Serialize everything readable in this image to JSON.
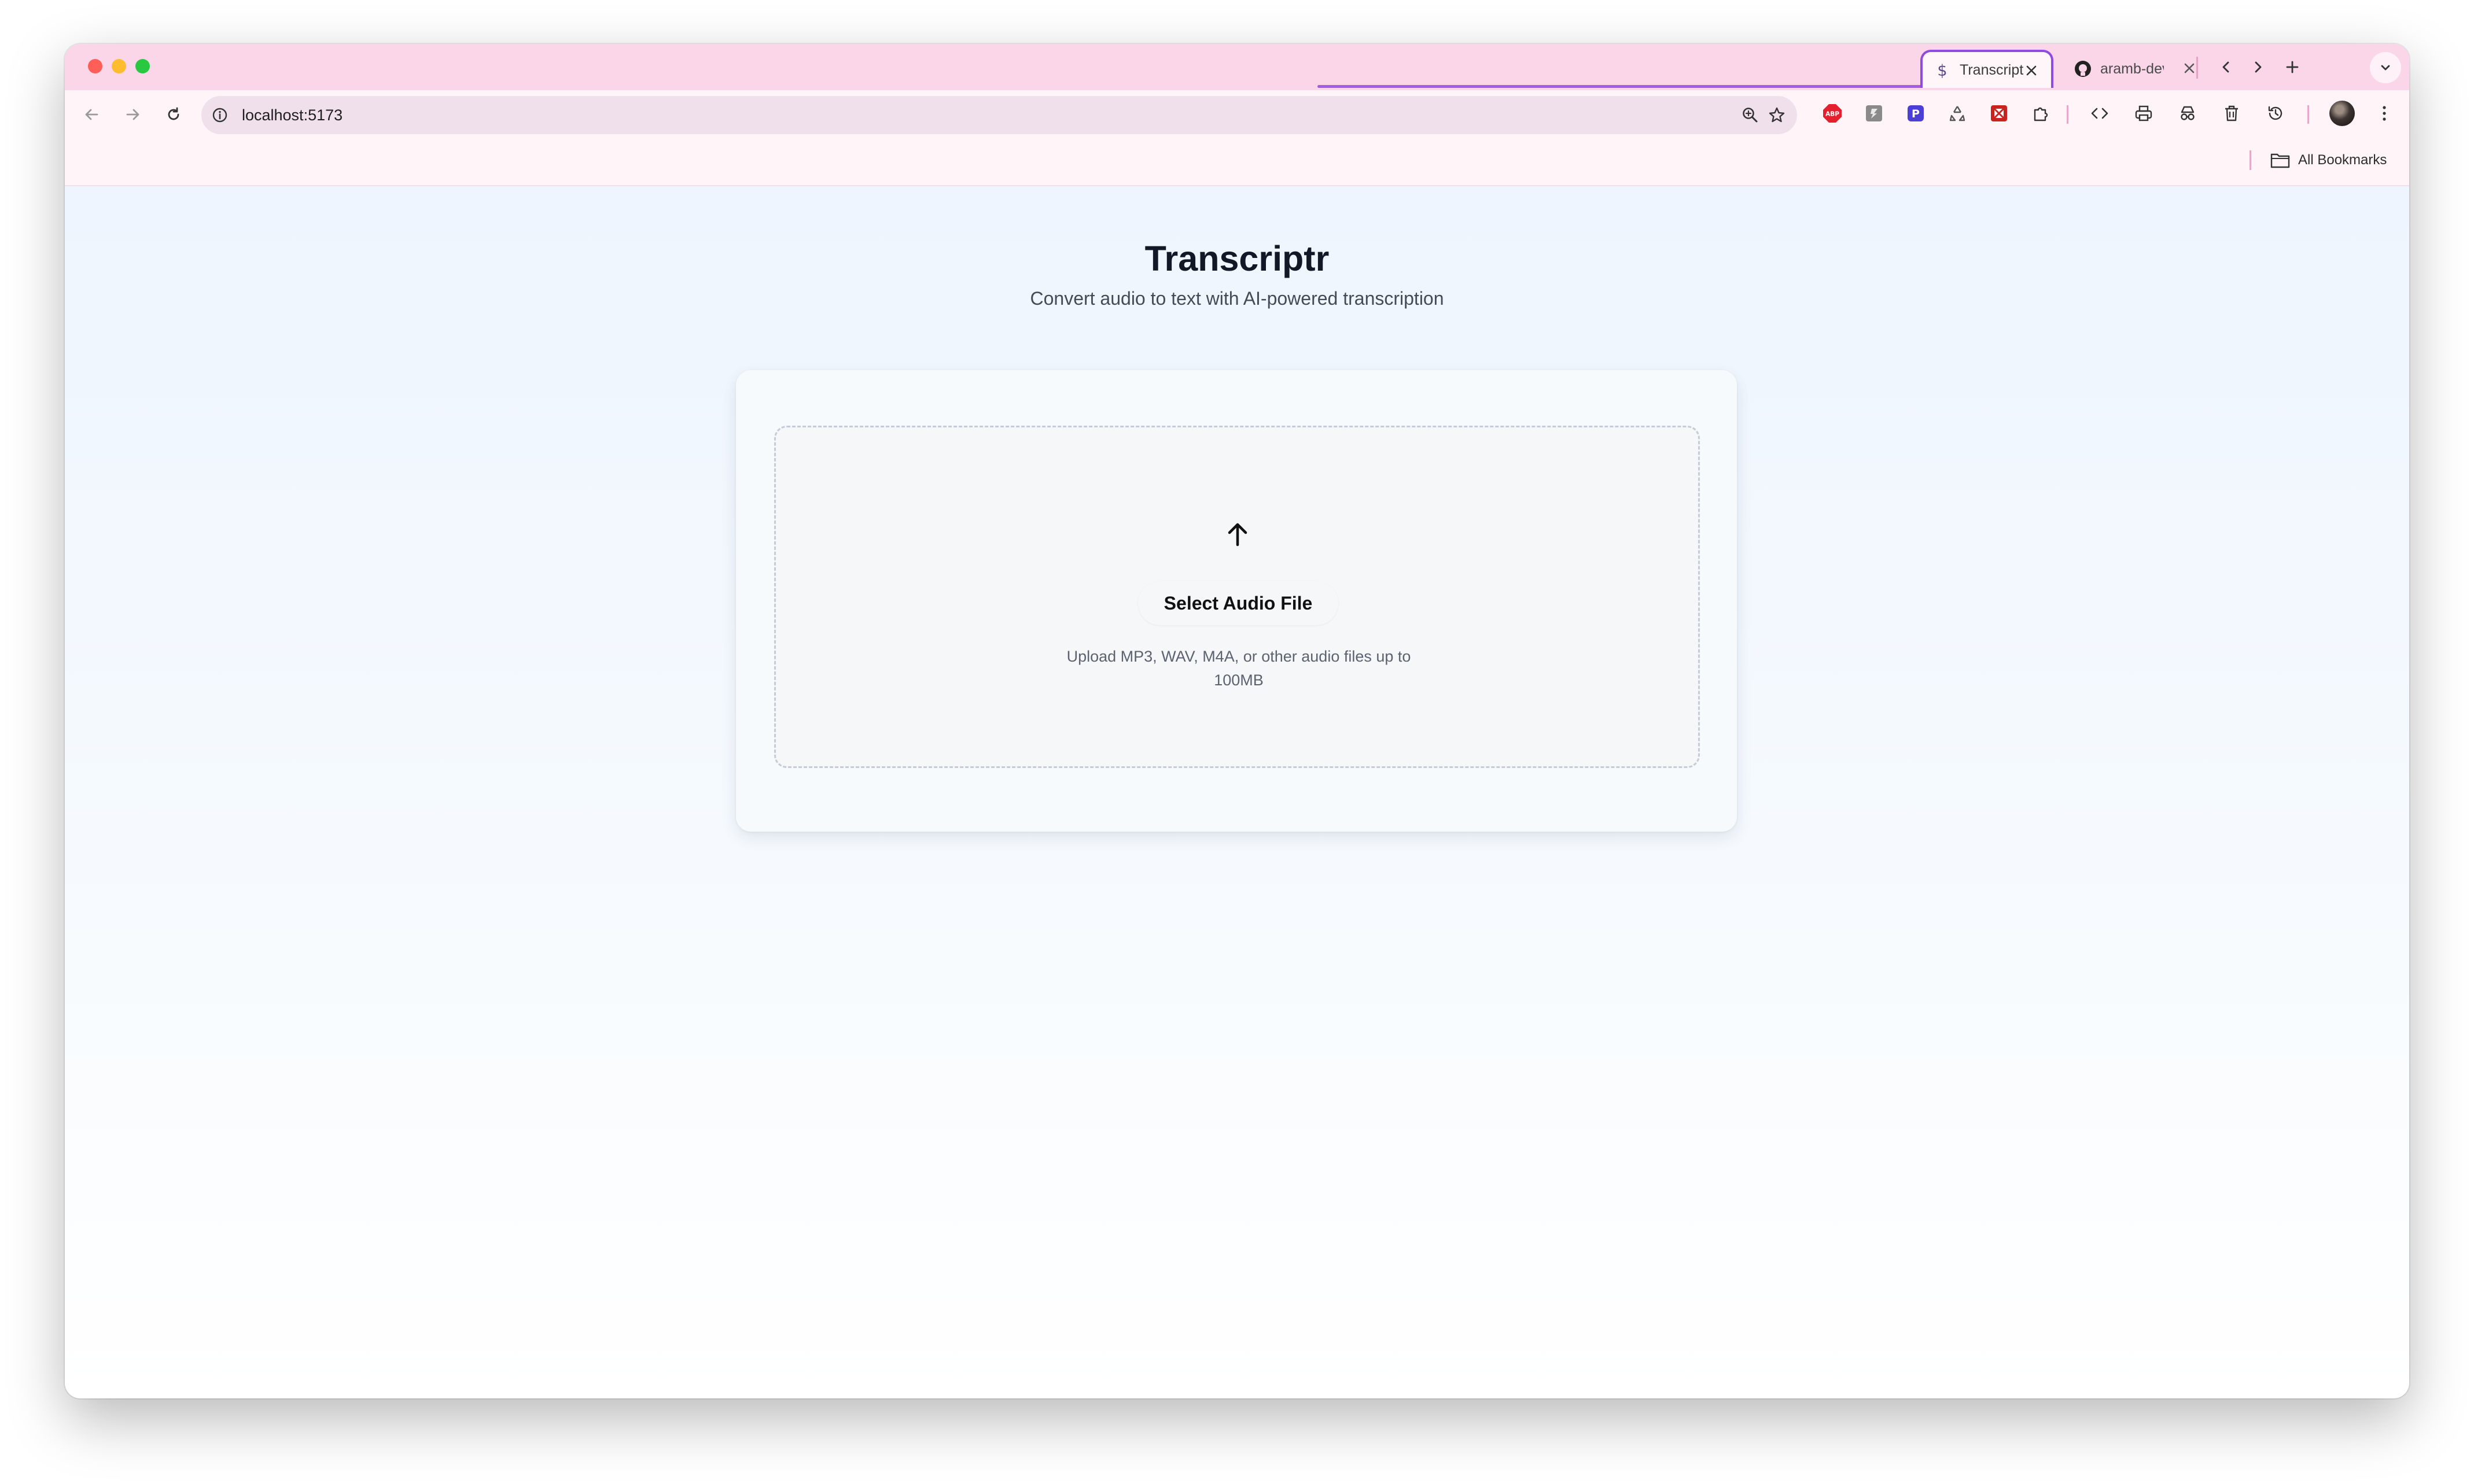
{
  "browser": {
    "tabs": [
      {
        "title": "Transcriptr",
        "icon": "dollar-sign-icon",
        "active": true
      },
      {
        "title": "aramb-dev",
        "icon": "github-icon",
        "active": false
      }
    ],
    "url": "localhost:5173",
    "bookmarks": {
      "all_label": "All Bookmarks"
    },
    "extensions": [
      "adblock-plus-icon",
      "extension-icon",
      "paypal-honey-icon",
      "recycle-icon",
      "extension-red-icon",
      "puzzle-icon"
    ],
    "accent": "#8d4be0"
  },
  "page": {
    "title": "Transcriptr",
    "subtitle": "Convert audio to text with AI-powered transcription"
  },
  "upload": {
    "button_label": "Select Audio File",
    "hint": "Upload MP3, WAV, M4A, or other audio files up to 100MB"
  }
}
